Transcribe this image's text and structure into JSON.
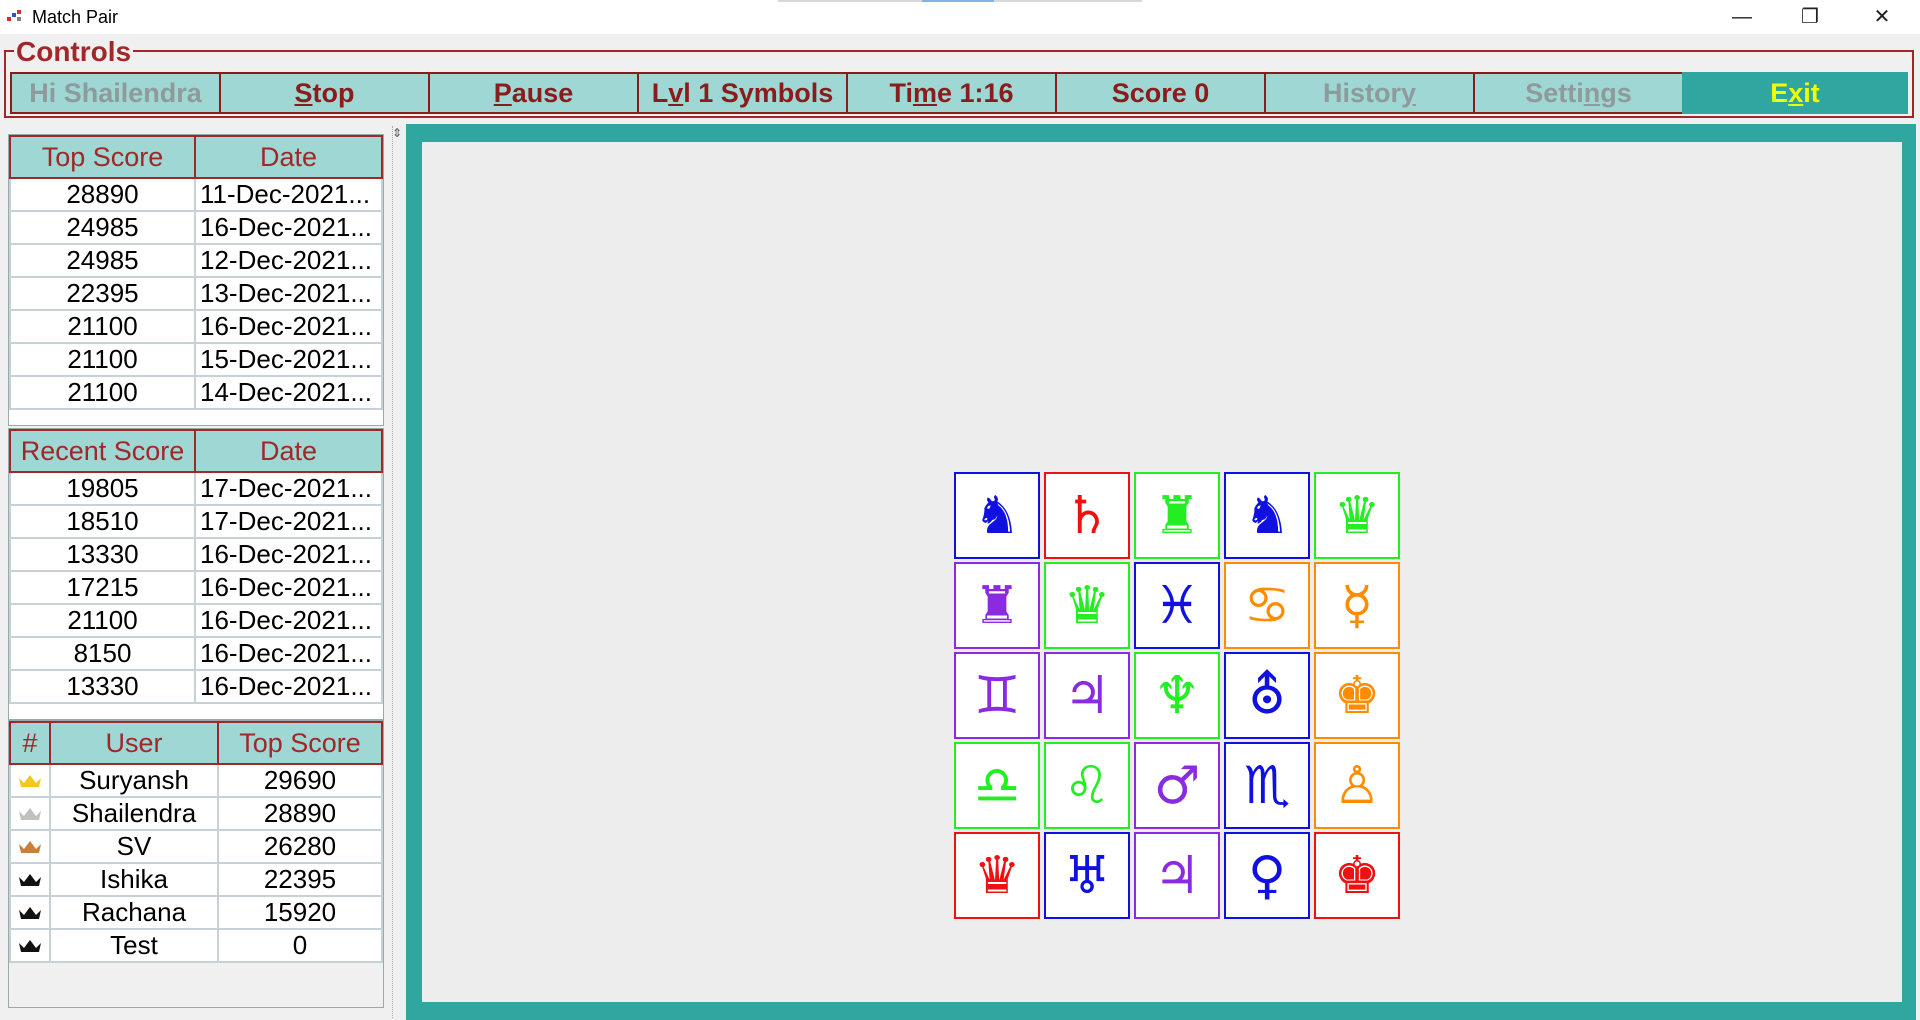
{
  "window": {
    "title": "Match Pair",
    "minimize": "—",
    "maximize": "❐",
    "close": "✕"
  },
  "controls": {
    "legend": "Controls",
    "buttons": [
      {
        "label": "Hi Shailendra",
        "state": "disabled"
      },
      {
        "label": "Stop",
        "underline_index": 0
      },
      {
        "label": "Pause",
        "underline_index": 0
      },
      {
        "label": "Lvl 1 Symbols",
        "underline_index": 1
      },
      {
        "label": "Time 1:16",
        "underline_index": 2
      },
      {
        "label": "Score 0"
      },
      {
        "label": "History",
        "state": "disabled",
        "underline_index": 6
      },
      {
        "label": "Settings",
        "state": "disabled",
        "underline_index": 5
      },
      {
        "label": "Exit",
        "underline_index": 1
      }
    ]
  },
  "top_scores": {
    "headers": [
      "Top Score",
      "Date"
    ],
    "rows": [
      [
        "28890",
        "11-Dec-2021..."
      ],
      [
        "24985",
        "16-Dec-2021..."
      ],
      [
        "24985",
        "12-Dec-2021..."
      ],
      [
        "22395",
        "13-Dec-2021..."
      ],
      [
        "21100",
        "16-Dec-2021..."
      ],
      [
        "21100",
        "15-Dec-2021..."
      ],
      [
        "21100",
        "14-Dec-2021..."
      ]
    ]
  },
  "recent_scores": {
    "headers": [
      "Recent Score",
      "Date"
    ],
    "rows": [
      [
        "19805",
        "17-Dec-2021..."
      ],
      [
        "18510",
        "17-Dec-2021..."
      ],
      [
        "13330",
        "16-Dec-2021..."
      ],
      [
        "17215",
        "16-Dec-2021..."
      ],
      [
        "21100",
        "16-Dec-2021..."
      ],
      [
        "8150",
        "16-Dec-2021..."
      ],
      [
        "13330",
        "16-Dec-2021..."
      ]
    ]
  },
  "leaderboard": {
    "headers": [
      "#",
      "User",
      "Top Score"
    ],
    "rows": [
      {
        "crown": "gold-crown-icon",
        "crown_color": "#f2c81e",
        "user": "Suryansh",
        "score": "29690"
      },
      {
        "crown": "silver-crown-icon",
        "crown_color": "#c0c0c0",
        "user": "Shailendra",
        "score": "28890"
      },
      {
        "crown": "bronze-crown-icon",
        "crown_color": "#c87f3a",
        "user": "SV",
        "score": "26280"
      },
      {
        "crown": "black-crown-icon",
        "crown_color": "#111111",
        "user": "Ishika",
        "score": "22395"
      },
      {
        "crown": "black-crown-icon",
        "crown_color": "#111111",
        "user": "Rachana",
        "score": "15920"
      },
      {
        "crown": "black-crown-icon",
        "crown_color": "#111111",
        "user": "Test",
        "score": "0"
      }
    ]
  },
  "board": {
    "frame_color": "#2fa6a0",
    "rows": 5,
    "cols": 5,
    "tiles": [
      {
        "symbol": "♞",
        "name": "knight-icon",
        "color": "#1010e0"
      },
      {
        "symbol": "♄",
        "name": "saturn-icon",
        "color": "#ee1111"
      },
      {
        "symbol": "♜",
        "name": "rook-icon",
        "color": "#22ee22"
      },
      {
        "symbol": "♞",
        "name": "knight-icon",
        "color": "#1010e0"
      },
      {
        "symbol": "♛",
        "name": "queen-icon",
        "color": "#22ee22"
      },
      {
        "symbol": "♜",
        "name": "rook-icon",
        "color": "#8a2be2"
      },
      {
        "symbol": "♛",
        "name": "queen-icon",
        "color": "#22ee22"
      },
      {
        "symbol": "♓",
        "name": "pisces-icon",
        "color": "#1010e0"
      },
      {
        "symbol": "♋",
        "name": "cancer-icon",
        "color": "#ff8c00"
      },
      {
        "symbol": "☿",
        "name": "mercury-icon",
        "color": "#ff8c00"
      },
      {
        "symbol": "♊",
        "name": "gemini-icon",
        "color": "#8a2be2"
      },
      {
        "symbol": "♃",
        "name": "jupiter-icon",
        "color": "#8a2be2"
      },
      {
        "symbol": "♆",
        "name": "neptune-icon",
        "color": "#22ee22"
      },
      {
        "symbol": "⛢",
        "name": "uranus-icon",
        "color": "#1010e0"
      },
      {
        "symbol": "♚",
        "name": "king-icon",
        "color": "#ff8c00"
      },
      {
        "symbol": "♎",
        "name": "libra-icon",
        "color": "#22ee22"
      },
      {
        "symbol": "♌",
        "name": "leo-icon",
        "color": "#22ee22"
      },
      {
        "symbol": "♂",
        "name": "mars-icon",
        "color": "#8a2be2"
      },
      {
        "symbol": "♏",
        "name": "scorpio-icon",
        "color": "#1010e0"
      },
      {
        "symbol": "♙",
        "name": "pawn-icon",
        "color": "#ff8c00"
      },
      {
        "symbol": "♛",
        "name": "queen-icon",
        "color": "#ee1111"
      },
      {
        "symbol": "♅",
        "name": "uranus-astro-icon",
        "color": "#1010e0"
      },
      {
        "symbol": "♃",
        "name": "jupiter-icon",
        "color": "#8a2be2"
      },
      {
        "symbol": "♀",
        "name": "venus-icon",
        "color": "#1010e0"
      },
      {
        "symbol": "♚",
        "name": "king-icon",
        "color": "#ee1111"
      }
    ]
  }
}
